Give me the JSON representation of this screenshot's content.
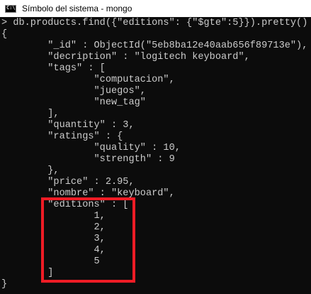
{
  "window": {
    "title": "Símbolo del sistema - mongo",
    "icon": "cmd-icon",
    "icon_text": "C:\\"
  },
  "terminal": {
    "lines": [
      "> db.products.find({\"editions\": {\"$gte\":5}}).pretty()",
      "{",
      "        \"_id\" : ObjectId(\"5eb8ba12e40aab656f89713e\"),",
      "        \"decription\" : \"logitech keyboard\",",
      "        \"tags\" : [",
      "                \"computacion\",",
      "                \"juegos\",",
      "                \"new_tag\"",
      "        ],",
      "        \"quantity\" : 3,",
      "        \"ratings\" : {",
      "                \"quality\" : 10,",
      "                \"strength\" : 9",
      "        },",
      "        \"price\" : 2.95,",
      "        \"nombre\" : \"keyboard\",",
      "        \"editions\" : [",
      "                1,",
      "                2,",
      "                3,",
      "                4,",
      "                5",
      "        ]",
      "}"
    ]
  },
  "colors": {
    "text": "#cccccc",
    "background": "#0c0c0c",
    "highlight": "#ee1c25"
  }
}
